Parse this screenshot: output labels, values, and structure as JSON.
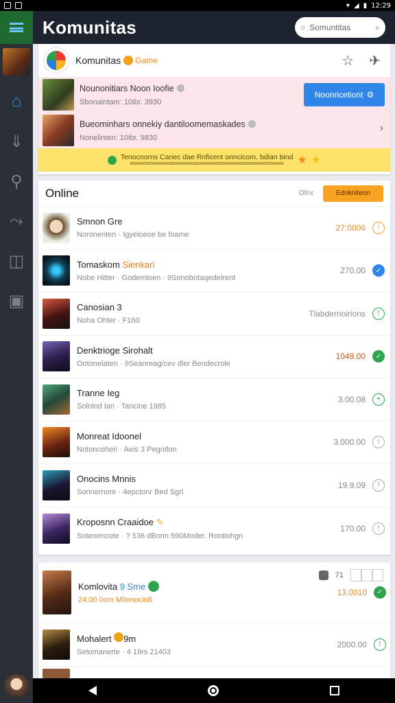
{
  "status_bar": {
    "time": "12:29"
  },
  "header": {
    "app_name": "Komunitas",
    "search_placeholder": "Somuntitas"
  },
  "community": {
    "name": "Komunitas",
    "badge": "Game",
    "notifications": [
      {
        "title": "Nounonitiars Noon Ioofie",
        "sub": "Sbonalntam: 10ibr. 3930"
      },
      {
        "title": "Bueominhars onnekiy dantiloomemaskades",
        "sub": "Nonelinten: 10ibr. 9830"
      }
    ],
    "notification_button": "Noonricetiont",
    "banner": "Tenocnorns Cariec dae Rnficent onncicom, bdian bind",
    "banner_small": "xxxxxxxxxxxxxxxxxxxxxxxxxxxxxxxxxxxxxxxxxxxxxxxxxxxxxxxxxxxxxxxx"
  },
  "online": {
    "title": "Online",
    "meta": "Ofnx",
    "button": "Ednkniteon",
    "users": [
      {
        "name": "Smnon Gre",
        "tag": "",
        "sub": "Noronenten  ·  Igyeloeoe be foame",
        "value": "27:0006",
        "value_style": "orange",
        "status": "orange",
        "status_icon": "!"
      },
      {
        "name": "Tomaskom ",
        "tag": "Sienkari",
        "sub": "Nobe Hitter  ·  Godemioen  ·  9Sonobotaqedelrent",
        "value": "270.00",
        "value_style": "",
        "status": "blue",
        "status_icon": "✓"
      },
      {
        "name": "Canosian 3",
        "tag": "",
        "sub": "Noha Ohter  ·  F160",
        "value": "Tlabdernoirions",
        "value_style": "",
        "status": "green-outline",
        "status_icon": "!"
      },
      {
        "name": "Denktrioge Sirohalt",
        "tag": "",
        "sub": "Ootonelaten  ·  9Seanreag/cev dler Bendecrole",
        "value": "1049.00",
        "value_style": "red",
        "status": "green",
        "status_icon": "✓"
      },
      {
        "name": "Tranne Ieg",
        "tag": "",
        "sub": "Solnlod Ian  ·  Tancine 1985",
        "value": "3.00.08",
        "value_style": "",
        "status": "green-outline",
        "status_icon": "+"
      },
      {
        "name": "Monreat Idoonel",
        "tag": "",
        "sub": "Notoncohen  ·  Aeis 3 Pegnifon",
        "value": "3.000.00",
        "value_style": "",
        "status": "",
        "status_icon": "!"
      },
      {
        "name": "Onocins Mnnis",
        "tag": "",
        "sub": "Sonnernonr  ·  4epctonr Bed Sgrl",
        "value": "19.9.09",
        "value_style": "",
        "status": "",
        "status_icon": "!"
      },
      {
        "name": "Kroposnn Craaidoe",
        "tag": "",
        "sub": "Sotenencote  ·  ? 536 dBonn 590Moder. Rontiohgn",
        "value": "170.00",
        "value_style": "",
        "status": "",
        "status_icon": "!"
      }
    ]
  },
  "community2": {
    "row1": {
      "name": "Komlovita ",
      "sme": "9 Sme",
      "sub": "24:00 0om  Milenocio8",
      "value": "13.0010",
      "status_icon": "✓",
      "count": "71"
    },
    "row2": {
      "name": "Mohalert ",
      "tag": "9m",
      "sub": "Setomanerte  ·  4 19rs 21403",
      "value": "2000.00",
      "status_icon": "!"
    }
  }
}
